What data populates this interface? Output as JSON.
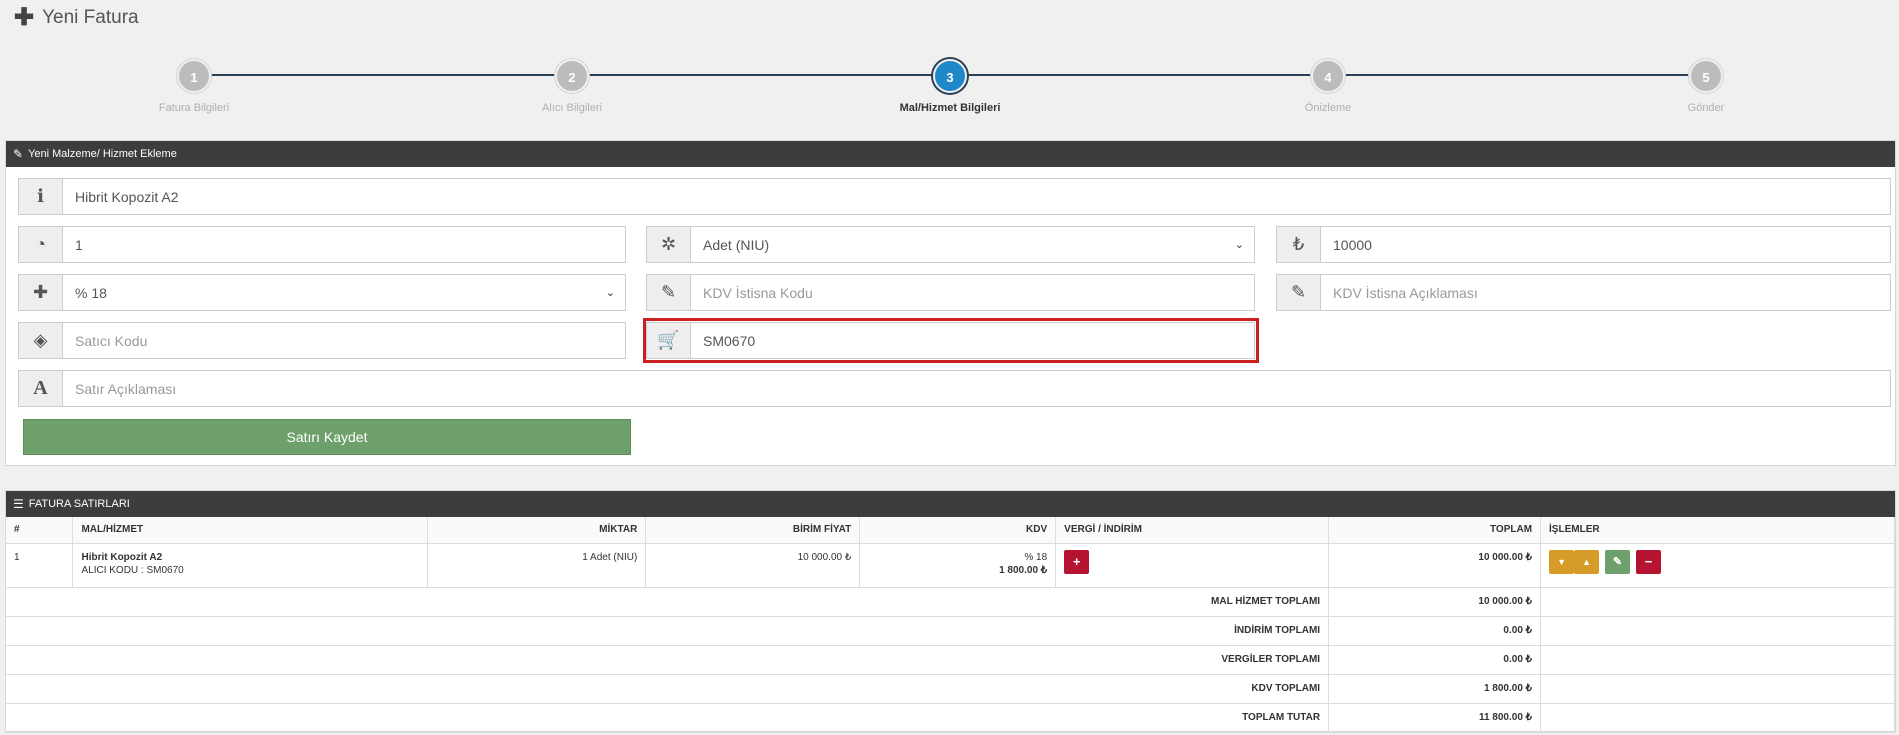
{
  "page": {
    "title": "Yeni Fatura"
  },
  "wizard": {
    "steps": [
      {
        "num": "1",
        "label": "Fatura Bilgileri"
      },
      {
        "num": "2",
        "label": "Alıcı Bilgileri"
      },
      {
        "num": "3",
        "label": "Mal/Hizmet Bilgileri"
      },
      {
        "num": "4",
        "label": "Önizleme"
      },
      {
        "num": "5",
        "label": "Gönder"
      }
    ],
    "active": "3"
  },
  "form": {
    "header": "Yeni Malzeme/ Hizmet Ekleme",
    "product_name": "Hibrit Kopozit A2",
    "quantity": "1",
    "unit": "Adet (NIU)",
    "unit_price": "10000",
    "vat_rate": "% 18",
    "vat_exemption_code_placeholder": "KDV İstisna Kodu",
    "vat_exemption_desc_placeholder": "KDV İstisna Açıklaması",
    "seller_code_placeholder": "Satıcı Kodu",
    "buyer_code": "SM0670",
    "line_desc_placeholder": "Satır Açıklaması",
    "save_label": "Satırı Kaydet"
  },
  "lines": {
    "header": "FATURA SATIRLARI",
    "columns": {
      "no": "#",
      "item": "MAL/HİZMET",
      "qty": "MİKTAR",
      "unit_price": "BİRİM FİYAT",
      "vat": "KDV",
      "tax_discount": "VERGİ / İNDİRİM",
      "total": "TOPLAM",
      "actions": "İŞLEMLER"
    },
    "rows": [
      {
        "no": "1",
        "item": "Hibrit Kopozit A2",
        "code": "ALICI KODU : SM0670",
        "qty": "1 Adet (NIU)",
        "unit_price": "10 000.00 ₺",
        "vat_rate": "% 18",
        "vat_amount": "1 800.00 ₺",
        "total": "10 000.00 ₺"
      }
    ],
    "totals": [
      {
        "label": "MAL HİZMET TOPLAMI",
        "value": "10 000.00 ₺"
      },
      {
        "label": "İNDİRİM TOPLAMI",
        "value": "0.00 ₺"
      },
      {
        "label": "VERGİLER TOPLAMI",
        "value": "0.00 ₺"
      },
      {
        "label": "KDV TOPLAMI",
        "value": "1 800.00 ₺"
      },
      {
        "label": "TOPLAM TUTAR",
        "value": "11 800.00 ₺"
      }
    ]
  },
  "colors": {
    "accent": "#1e88c8",
    "header_bg": "#3d3d3d",
    "save": "#6da06b",
    "danger": "#b5132f",
    "warning": "#d69c27",
    "highlight": "#cc1f1f"
  }
}
